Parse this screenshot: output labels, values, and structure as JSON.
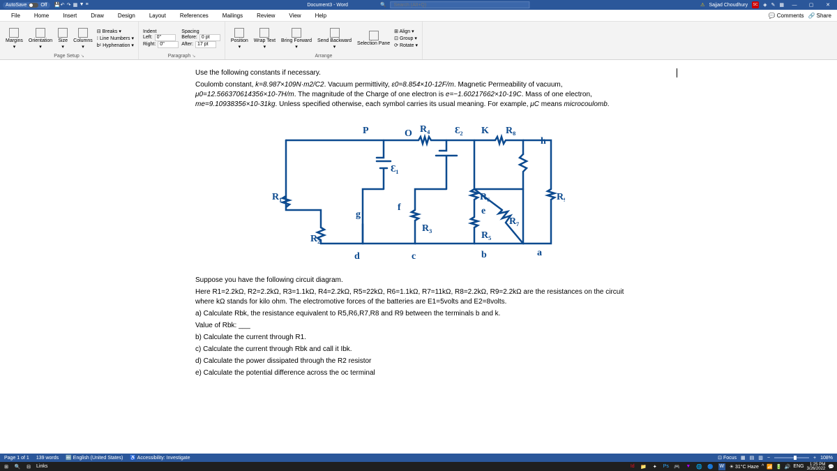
{
  "title_bar": {
    "autosave": "AutoSave",
    "autosave_state": "Off",
    "doc_title": "Document3 - Word",
    "search_placeholder": "Search (Alt+Q)",
    "user_name": "Sajjad Choudhury",
    "user_initials": "SC"
  },
  "tabs": {
    "file": "File",
    "home": "Home",
    "insert": "Insert",
    "draw": "Draw",
    "design": "Design",
    "layout": "Layout",
    "references": "References",
    "mailings": "Mailings",
    "review": "Review",
    "view": "View",
    "help": "Help",
    "comments": "Comments",
    "share": "Share"
  },
  "ribbon": {
    "page_setup": {
      "margins": "Margins",
      "orientation": "Orientation",
      "size": "Size",
      "columns": "Columns",
      "breaks": "Breaks",
      "line_numbers": "Line Numbers",
      "hyphenation": "Hyphenation",
      "label": "Page Setup"
    },
    "paragraph": {
      "indent": "Indent",
      "spacing": "Spacing",
      "left": "Left:",
      "right": "Right:",
      "before": "Before:",
      "after": "After:",
      "left_val": "0\"",
      "right_val": "0\"",
      "before_val": "0 pt",
      "after_val": "17 pt",
      "label": "Paragraph"
    },
    "arrange": {
      "position": "Position",
      "wrap": "Wrap Text",
      "bring": "Bring Forward",
      "send": "Send Backward",
      "selection": "Selection Pane",
      "align": "Align",
      "group": "Group",
      "rotate": "Rotate",
      "label": "Arrange"
    }
  },
  "document": {
    "p1": "Use the following constants if necessary.",
    "p2a": "Coulomb constant, ",
    "p2b": "k=8.987×109N·m2/C2",
    "p2c": ". Vacuum permittivity, ",
    "p2d": "ε0=8.854×10-12F/m",
    "p2e": ". Magnetic Permeability of vacuum, ",
    "p2f": "μ0=12.566370614356×10-7H/m",
    "p2g": ". The magnitude of the Charge of one electron is ",
    "p2h": "e=−1.60217662×10-19C",
    "p2i": ". Mass of one electron, ",
    "p2j": "me=9.10938356×10-31kg",
    "p2k": ". Unless specified otherwise, each symbol carries its usual meaning. For example, ",
    "p2l": "μC",
    "p2m": " means ",
    "p2n": "microcoulomb",
    "p2o": ".",
    "p3": "Suppose you have the following circuit diagram.",
    "p4": "Here R1=2.2kΩ, R2=2.2kΩ, R3=1.1kΩ, R4=2.2kΩ, R5=22kΩ, R6=1.1kΩ, R7=11kΩ, R8=2.2kΩ, R9=2.2kΩ are the resistances on the circuit where kΩ stands for kilo ohm. The electromotive forces of the batteries are E1=5volts and E2=8volts.",
    "p5a": "a) Calculate Rbk, the resistance equivalent to R5,R6,R7,R8 and R9 between the terminals b and k.",
    "p5b": "Value of Rbk: ___",
    "p6": "b) Calculate the current through R1.",
    "p7": "c) Calculate the current through Rbk and call it Ibk.",
    "p8": "d) Calculate the power dissipated through the R2 resistor",
    "p9": "e) Calculate the potential difference across the oc terminal"
  },
  "circuit": {
    "R1": "R₁",
    "R2": "R₂",
    "R3": "R₃",
    "R4": "R₄",
    "R5": "R₅",
    "R6": "R₆",
    "R7": "R₇",
    "R8": "R₈",
    "R9": "R₉",
    "E1": "Ɛ₁",
    "E2": "Ɛ₂",
    "P": "P",
    "O": "O",
    "K": "K",
    "a": "a",
    "b": "b",
    "c": "c",
    "d": "d",
    "e": "e",
    "f": "f",
    "g": "g",
    "h": "h"
  },
  "status": {
    "page": "Page 1 of 1",
    "words": "139 words",
    "lang": "English (United States)",
    "access": "Accessibility: Investigate",
    "focus": "Focus",
    "zoom": "108%"
  },
  "taskbar": {
    "links": "Links",
    "weather": "31°C Haze",
    "lang": "ENG",
    "time": "1:25 PM",
    "date": "3/26/2022"
  }
}
